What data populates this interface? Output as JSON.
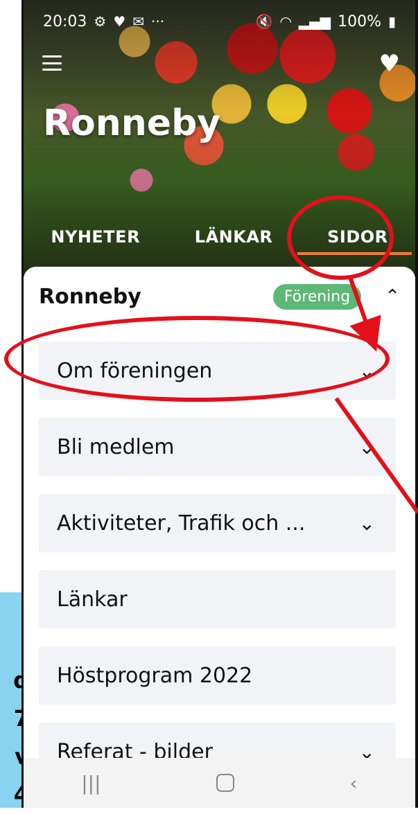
{
  "left_overlay": {
    "chars": [
      "d",
      "7",
      "v",
      "4"
    ]
  },
  "status_bar": {
    "time": "20:03",
    "left_icons": [
      "settings-icon",
      "heart-pulse-icon",
      "mail-icon",
      "more-icon"
    ],
    "right_text": "100%"
  },
  "header": {
    "title": "Ronneby",
    "favorite": "heart-icon"
  },
  "tabs": [
    {
      "label": "NYHETER"
    },
    {
      "label": "LÄNKAR"
    },
    {
      "label": "SIDOR"
    }
  ],
  "card": {
    "title": "Ronneby",
    "badge": "Förening",
    "items": [
      {
        "label": "Om föreningen",
        "has_chevron": true
      },
      {
        "label": "Bli medlem",
        "has_chevron": true
      },
      {
        "label": "Aktiviteter, Trafik och ...",
        "has_chevron": true
      },
      {
        "label": "Länkar",
        "has_chevron": false
      },
      {
        "label": "Höstprogram 2022",
        "has_chevron": false
      },
      {
        "label": "Referat - bilder",
        "has_chevron": true
      }
    ]
  },
  "colors": {
    "accent": "#f47a2c",
    "badge": "#5cb876",
    "annotation": "#e3101a"
  }
}
